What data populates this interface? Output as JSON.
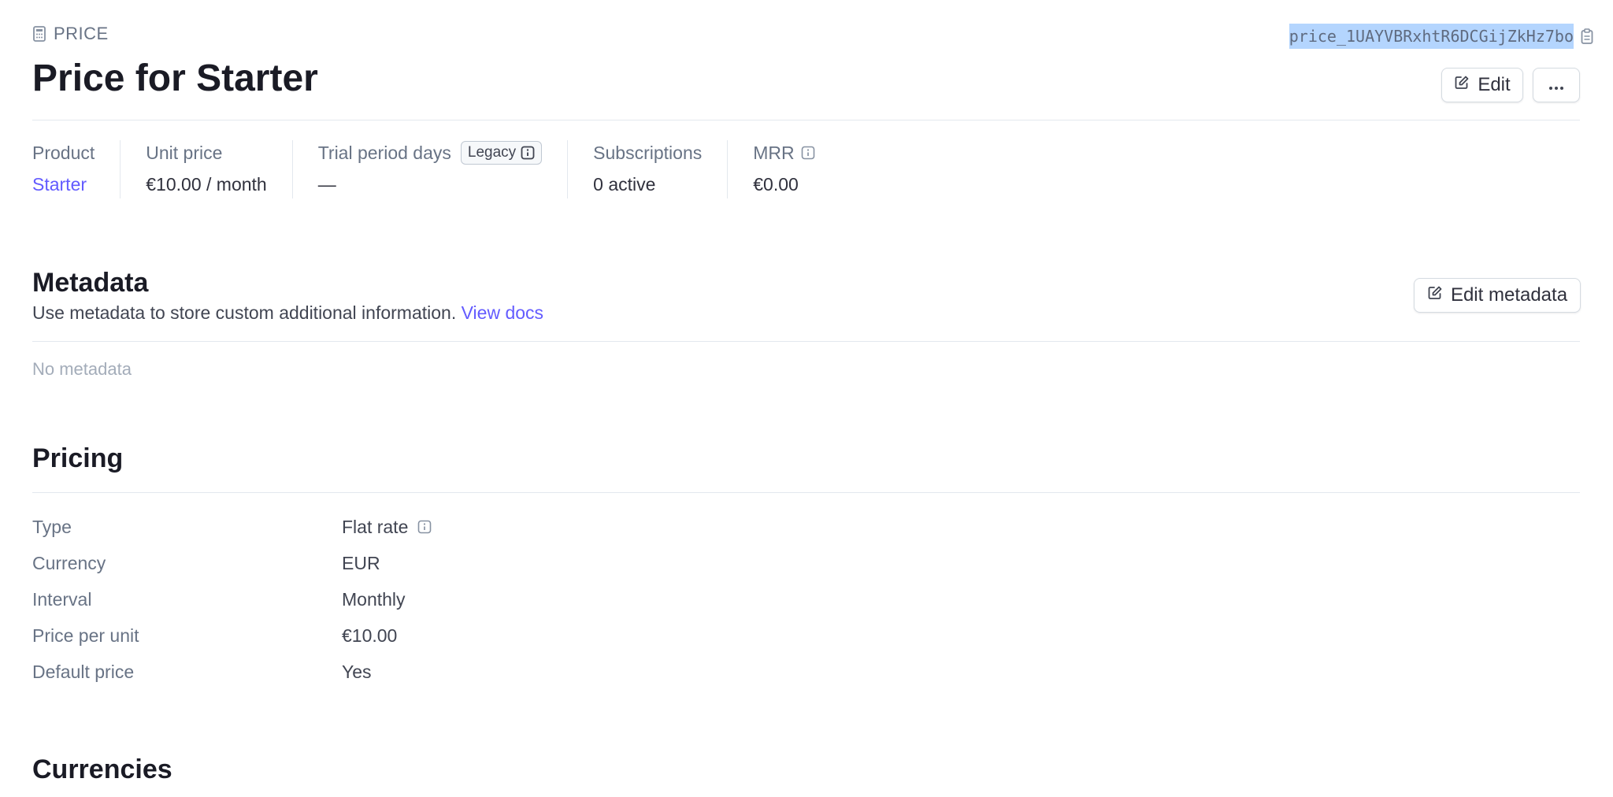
{
  "header": {
    "kicker": "PRICE",
    "title": "Price for Starter",
    "price_id": "price_1UAYVBRxhtR6DCGijZkHz7bo",
    "edit_label": "Edit",
    "more_label": "···"
  },
  "summary": {
    "product_label": "Product",
    "product_value": "Starter",
    "unit_price_label": "Unit price",
    "unit_price_value": "€10.00 / month",
    "trial_label": "Trial period days",
    "trial_badge": "Legacy",
    "trial_value": "—",
    "subscriptions_label": "Subscriptions",
    "subscriptions_value": "0 active",
    "mrr_label": "MRR",
    "mrr_value": "€0.00"
  },
  "metadata": {
    "title": "Metadata",
    "description": "Use metadata to store custom additional information.",
    "docs_link": "View docs",
    "edit_label": "Edit metadata",
    "empty_text": "No metadata"
  },
  "pricing": {
    "title": "Pricing",
    "rows": [
      {
        "key": "Type",
        "value": "Flat rate"
      },
      {
        "key": "Currency",
        "value": "EUR"
      },
      {
        "key": "Interval",
        "value": "Monthly"
      },
      {
        "key": "Price per unit",
        "value": "€10.00"
      },
      {
        "key": "Default price",
        "value": "Yes"
      }
    ]
  },
  "currencies": {
    "title": "Currencies"
  },
  "colors": {
    "link": "#635bff",
    "selection": "#b4d5fe",
    "muted": "#687385",
    "heading": "#1a1b25"
  },
  "icons": [
    "calculator-icon",
    "clipboard-icon",
    "edit-pencil-icon",
    "more-icon",
    "info-icon"
  ]
}
